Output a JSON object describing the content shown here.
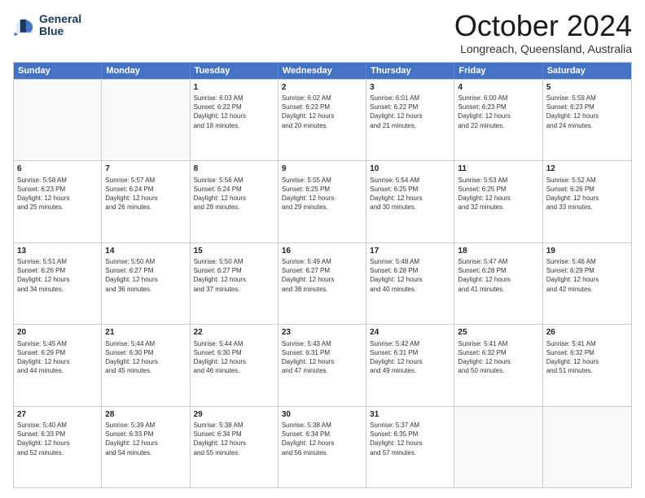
{
  "header": {
    "logo_line1": "General",
    "logo_line2": "Blue",
    "month": "October 2024",
    "location": "Longreach, Queensland, Australia"
  },
  "days_of_week": [
    "Sunday",
    "Monday",
    "Tuesday",
    "Wednesday",
    "Thursday",
    "Friday",
    "Saturday"
  ],
  "rows": [
    [
      {
        "day": "",
        "lines": [],
        "empty": true
      },
      {
        "day": "",
        "lines": [],
        "empty": true
      },
      {
        "day": "1",
        "lines": [
          "Sunrise: 6:03 AM",
          "Sunset: 6:22 PM",
          "Daylight: 12 hours",
          "and 18 minutes."
        ]
      },
      {
        "day": "2",
        "lines": [
          "Sunrise: 6:02 AM",
          "Sunset: 6:22 PM",
          "Daylight: 12 hours",
          "and 20 minutes."
        ]
      },
      {
        "day": "3",
        "lines": [
          "Sunrise: 6:01 AM",
          "Sunset: 6:22 PM",
          "Daylight: 12 hours",
          "and 21 minutes."
        ]
      },
      {
        "day": "4",
        "lines": [
          "Sunrise: 6:00 AM",
          "Sunset: 6:23 PM",
          "Daylight: 12 hours",
          "and 22 minutes."
        ]
      },
      {
        "day": "5",
        "lines": [
          "Sunrise: 5:59 AM",
          "Sunset: 6:23 PM",
          "Daylight: 12 hours",
          "and 24 minutes."
        ]
      }
    ],
    [
      {
        "day": "6",
        "lines": [
          "Sunrise: 5:58 AM",
          "Sunset: 6:23 PM",
          "Daylight: 12 hours",
          "and 25 minutes."
        ]
      },
      {
        "day": "7",
        "lines": [
          "Sunrise: 5:57 AM",
          "Sunset: 6:24 PM",
          "Daylight: 12 hours",
          "and 26 minutes."
        ]
      },
      {
        "day": "8",
        "lines": [
          "Sunrise: 5:56 AM",
          "Sunset: 6:24 PM",
          "Daylight: 12 hours",
          "and 28 minutes."
        ]
      },
      {
        "day": "9",
        "lines": [
          "Sunrise: 5:55 AM",
          "Sunset: 6:25 PM",
          "Daylight: 12 hours",
          "and 29 minutes."
        ]
      },
      {
        "day": "10",
        "lines": [
          "Sunrise: 5:54 AM",
          "Sunset: 6:25 PM",
          "Daylight: 12 hours",
          "and 30 minutes."
        ]
      },
      {
        "day": "11",
        "lines": [
          "Sunrise: 5:53 AM",
          "Sunset: 6:25 PM",
          "Daylight: 12 hours",
          "and 32 minutes."
        ]
      },
      {
        "day": "12",
        "lines": [
          "Sunrise: 5:52 AM",
          "Sunset: 6:26 PM",
          "Daylight: 12 hours",
          "and 33 minutes."
        ]
      }
    ],
    [
      {
        "day": "13",
        "lines": [
          "Sunrise: 5:51 AM",
          "Sunset: 6:26 PM",
          "Daylight: 12 hours",
          "and 34 minutes."
        ]
      },
      {
        "day": "14",
        "lines": [
          "Sunrise: 5:50 AM",
          "Sunset: 6:27 PM",
          "Daylight: 12 hours",
          "and 36 minutes."
        ]
      },
      {
        "day": "15",
        "lines": [
          "Sunrise: 5:50 AM",
          "Sunset: 6:27 PM",
          "Daylight: 12 hours",
          "and 37 minutes."
        ]
      },
      {
        "day": "16",
        "lines": [
          "Sunrise: 5:49 AM",
          "Sunset: 6:27 PM",
          "Daylight: 12 hours",
          "and 38 minutes."
        ]
      },
      {
        "day": "17",
        "lines": [
          "Sunrise: 5:48 AM",
          "Sunset: 6:28 PM",
          "Daylight: 12 hours",
          "and 40 minutes."
        ]
      },
      {
        "day": "18",
        "lines": [
          "Sunrise: 5:47 AM",
          "Sunset: 6:28 PM",
          "Daylight: 12 hours",
          "and 41 minutes."
        ]
      },
      {
        "day": "19",
        "lines": [
          "Sunrise: 5:46 AM",
          "Sunset: 6:29 PM",
          "Daylight: 12 hours",
          "and 42 minutes."
        ]
      }
    ],
    [
      {
        "day": "20",
        "lines": [
          "Sunrise: 5:45 AM",
          "Sunset: 6:29 PM",
          "Daylight: 12 hours",
          "and 44 minutes."
        ]
      },
      {
        "day": "21",
        "lines": [
          "Sunrise: 5:44 AM",
          "Sunset: 6:30 PM",
          "Daylight: 12 hours",
          "and 45 minutes."
        ]
      },
      {
        "day": "22",
        "lines": [
          "Sunrise: 5:44 AM",
          "Sunset: 6:30 PM",
          "Daylight: 12 hours",
          "and 46 minutes."
        ]
      },
      {
        "day": "23",
        "lines": [
          "Sunrise: 5:43 AM",
          "Sunset: 6:31 PM",
          "Daylight: 12 hours",
          "and 47 minutes."
        ]
      },
      {
        "day": "24",
        "lines": [
          "Sunrise: 5:42 AM",
          "Sunset: 6:31 PM",
          "Daylight: 12 hours",
          "and 49 minutes."
        ]
      },
      {
        "day": "25",
        "lines": [
          "Sunrise: 5:41 AM",
          "Sunset: 6:32 PM",
          "Daylight: 12 hours",
          "and 50 minutes."
        ]
      },
      {
        "day": "26",
        "lines": [
          "Sunrise: 5:41 AM",
          "Sunset: 6:32 PM",
          "Daylight: 12 hours",
          "and 51 minutes."
        ]
      }
    ],
    [
      {
        "day": "27",
        "lines": [
          "Sunrise: 5:40 AM",
          "Sunset: 6:33 PM",
          "Daylight: 12 hours",
          "and 52 minutes."
        ]
      },
      {
        "day": "28",
        "lines": [
          "Sunrise: 5:39 AM",
          "Sunset: 6:33 PM",
          "Daylight: 12 hours",
          "and 54 minutes."
        ]
      },
      {
        "day": "29",
        "lines": [
          "Sunrise: 5:38 AM",
          "Sunset: 6:34 PM",
          "Daylight: 12 hours",
          "and 55 minutes."
        ]
      },
      {
        "day": "30",
        "lines": [
          "Sunrise: 5:38 AM",
          "Sunset: 6:34 PM",
          "Daylight: 12 hours",
          "and 56 minutes."
        ]
      },
      {
        "day": "31",
        "lines": [
          "Sunrise: 5:37 AM",
          "Sunset: 6:35 PM",
          "Daylight: 12 hours",
          "and 57 minutes."
        ]
      },
      {
        "day": "",
        "lines": [],
        "empty": true
      },
      {
        "day": "",
        "lines": [],
        "empty": true
      }
    ]
  ]
}
